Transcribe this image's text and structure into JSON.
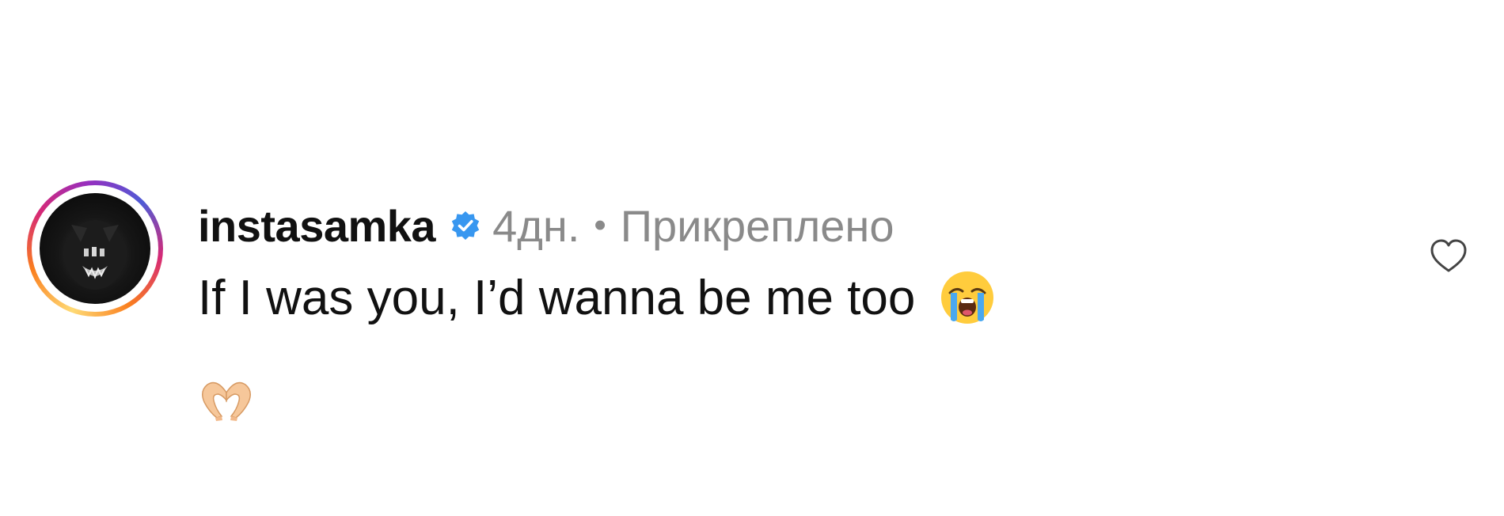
{
  "comment": {
    "username": "instasamka",
    "verified": true,
    "time": "4дн.",
    "separator": "•",
    "pinned_label": "Прикреплено",
    "text": "If I was you, I’d wanna be me too",
    "emojis": [
      "loudly-crying-face",
      "heart-hands"
    ],
    "like_icon": "heart-outline-icon"
  },
  "colors": {
    "verified_blue": "#3897f0",
    "meta_gray": "#8a8a8a",
    "text": "#111111"
  }
}
